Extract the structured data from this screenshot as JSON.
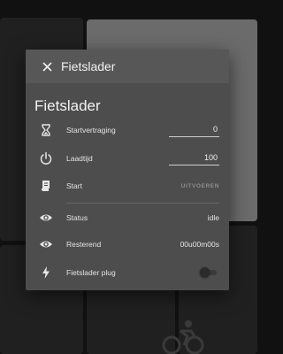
{
  "dialog": {
    "title": "Fietslader",
    "card_title": "Fietslader",
    "rows": [
      {
        "icon": "hourglass-icon",
        "label": "Startvertraging",
        "type": "input",
        "value": "0"
      },
      {
        "icon": "power-icon",
        "label": "Laadtijd",
        "type": "input",
        "value": "100"
      },
      {
        "icon": "script-icon",
        "label": "Start",
        "type": "action",
        "action_label": "UITVOEREN"
      },
      {
        "icon": "eye-icon",
        "label": "Status",
        "type": "text",
        "value": "idle"
      },
      {
        "icon": "eye-icon",
        "label": "Resterend",
        "type": "text",
        "value": "00u00m00s"
      },
      {
        "icon": "flash-icon",
        "label": "Fietslader plug",
        "type": "toggle",
        "state": "off"
      }
    ]
  },
  "background": {
    "tile_icon": "bicycle-icon"
  },
  "colors": {
    "page_bg": "#111111",
    "dialog_bg": "#4d4d4d",
    "header_bg": "#575757",
    "highlight_tile": "#6b6b6b"
  }
}
